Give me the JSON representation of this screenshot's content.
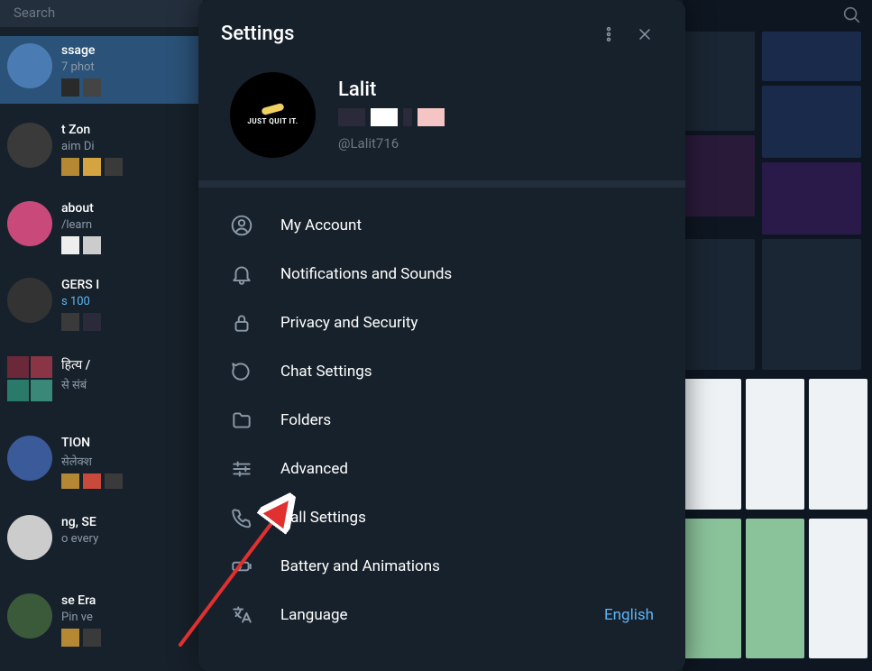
{
  "search_placeholder": "Search",
  "chats": [
    {
      "title": "ssage",
      "sub": "7 phot"
    },
    {
      "title": "t Zon",
      "sub": "aim Di"
    },
    {
      "title": "about",
      "sub": "/learn"
    },
    {
      "title": "GERS I",
      "sub": "s 100",
      "sub_blue": true
    },
    {
      "title": "हित्य /",
      "sub": "से संबं"
    },
    {
      "title": "TION",
      "sub": "सेलेक्श"
    },
    {
      "title": "ng, SE",
      "sub": "o every"
    },
    {
      "title": "se Era",
      "sub": "Pin ve"
    }
  ],
  "modal": {
    "title": "Settings",
    "profile": {
      "name": "Lalit",
      "avatar_text": "JUST QUIT IT.",
      "handle": "@Lalit716"
    },
    "items": [
      {
        "label": "My Account"
      },
      {
        "label": "Notifications and Sounds"
      },
      {
        "label": "Privacy and Security"
      },
      {
        "label": "Chat Settings"
      },
      {
        "label": "Folders"
      },
      {
        "label": "Advanced"
      },
      {
        "label": "Call Settings"
      },
      {
        "label": "Battery and Animations"
      },
      {
        "label": "Language",
        "value": "English"
      }
    ]
  }
}
